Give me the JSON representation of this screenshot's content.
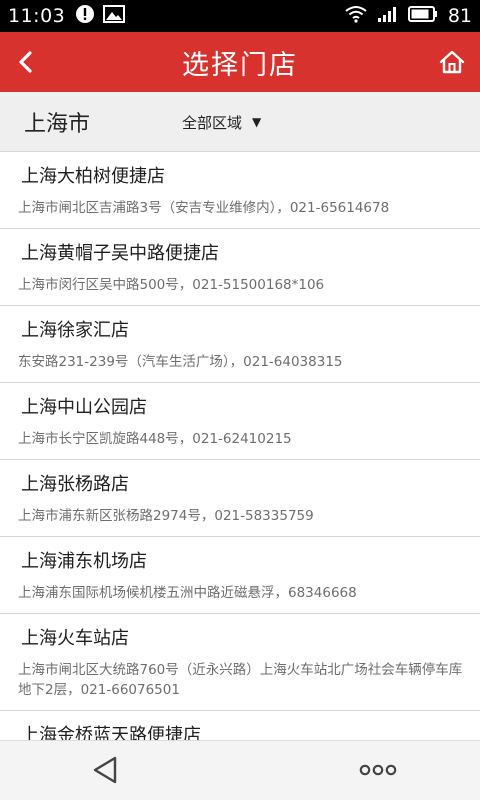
{
  "status_bar": {
    "time": "11:03",
    "battery_level": "81",
    "icons": [
      "alert-circle-icon",
      "image-icon",
      "wifi-icon",
      "signal-icon",
      "battery-icon"
    ]
  },
  "title_bar": {
    "title": "选择门店",
    "background_color": "#d7322d",
    "back_icon": "chevron-left-icon",
    "home_icon": "home-icon"
  },
  "filter": {
    "city": "上海市",
    "region_selected": "全部区域",
    "caret": "▼"
  },
  "stores": [
    {
      "name": "上海大柏树便捷店",
      "address": "上海市闸北区吉浦路3号（安吉专业维修内），021-65614678"
    },
    {
      "name": "上海黄帽子吴中路便捷店",
      "address": "上海市闵行区吴中路500号，021-51500168*106"
    },
    {
      "name": "上海徐家汇店",
      "address": "东安路231-239号（汽车生活广场），021-64038315"
    },
    {
      "name": "上海中山公园店",
      "address": "上海市长宁区凯旋路448号，021-62410215"
    },
    {
      "name": "上海张杨路店",
      "address": "上海市浦东新区张杨路2974号，021-58335759"
    },
    {
      "name": "上海浦东机场店",
      "address": "上海浦东国际机场候机楼五洲中路近磁悬浮，68346668"
    },
    {
      "name": "上海火车站店",
      "address": "上海市闸北区大统路760号（近永兴路）上海火车站北广场社会车辆停车库地下2层，021-66076501"
    },
    {
      "name": "上海金桥蓝天路便捷店",
      "address": ""
    }
  ],
  "nav_bar": {
    "back_icon": "triangle-back-icon",
    "menu_icon": "more-dots-icon"
  }
}
